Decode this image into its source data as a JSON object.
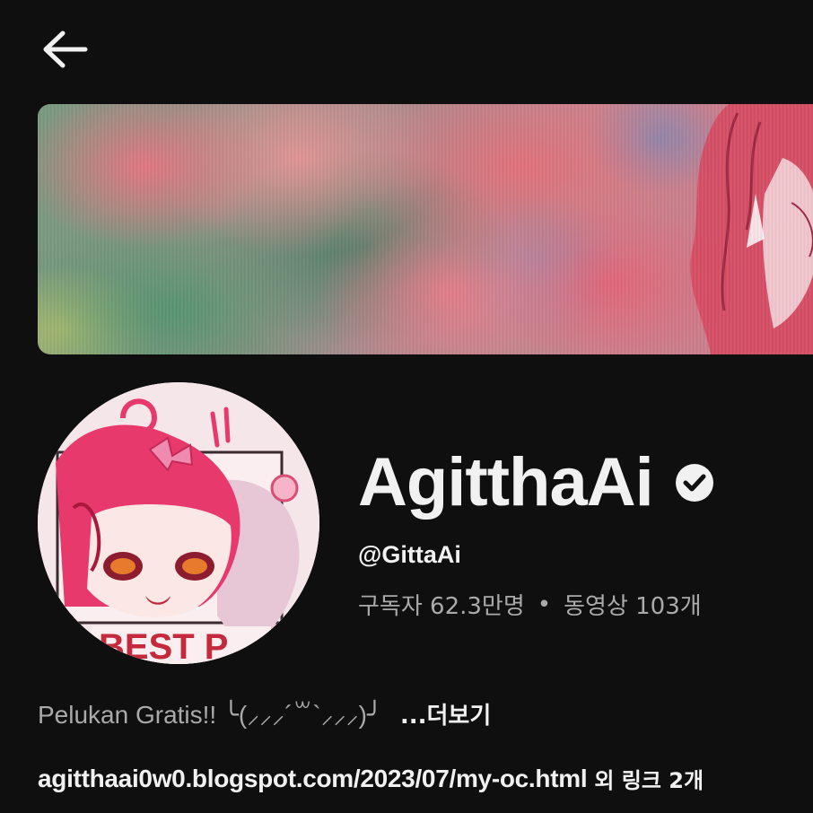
{
  "header": {
    "back_icon": "arrow-left-icon"
  },
  "channel": {
    "name": "AgitthaAi",
    "verified_icon": "verified-check-icon",
    "handle": "@GittaAi",
    "subscribers": "구독자 62.3만명",
    "separator": "•",
    "videos": "동영상 103개",
    "description": "Pelukan Gratis!!  ╰(⸝⸝⸝´꒳`⸝⸝⸝)╯",
    "more_label": "...더보기",
    "link_url": "agitthaai0w0.blogspot.com/2023/07/my-oc.html",
    "link_extra": "외 링크 2개"
  },
  "colors": {
    "background": "#0f0f0f",
    "primary_text": "#f1f1f1",
    "secondary_text": "#aaaaaa"
  }
}
